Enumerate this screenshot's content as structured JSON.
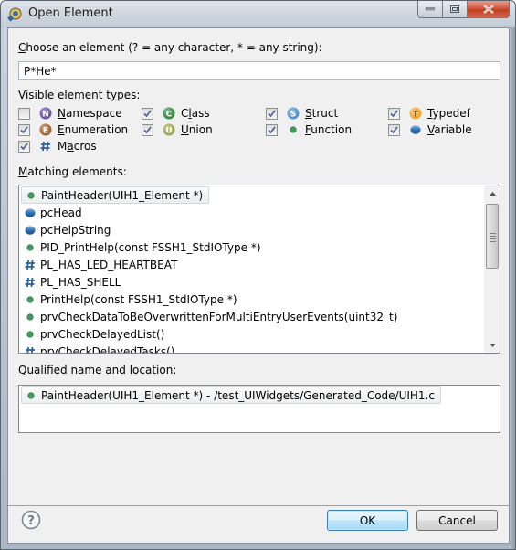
{
  "window": {
    "title": "Open Element",
    "caption_buttons": [
      "minimize",
      "maximize",
      "close"
    ]
  },
  "filter": {
    "label": "Choose an element (? = any character, * = any string):",
    "mnemonic_char": "C",
    "value": "P*He*"
  },
  "types": {
    "label": "Visible element types:",
    "items": [
      {
        "label": "Namespace",
        "mnemonic": "N",
        "checked": false,
        "icon": "namespace-icon",
        "color": "#6b4fa6"
      },
      {
        "label": "Class",
        "mnemonic": "l",
        "checked": true,
        "icon": "class-icon",
        "color": "#2e8b3e"
      },
      {
        "label": "Struct",
        "mnemonic": "S",
        "checked": true,
        "icon": "struct-icon",
        "color": "#4a93cf"
      },
      {
        "label": "Typedef",
        "mnemonic": "T",
        "checked": true,
        "icon": "typedef-icon",
        "color": "#f0a830"
      },
      {
        "label": "Enumeration",
        "mnemonic": "E",
        "checked": true,
        "icon": "enumeration-icon",
        "color": "#a0622a"
      },
      {
        "label": "Union",
        "mnemonic": "U",
        "checked": true,
        "icon": "union-icon",
        "color": "#9aa84a"
      },
      {
        "label": "Function",
        "mnemonic": "F",
        "checked": true,
        "icon": "function-icon",
        "color": "#3f9a5c"
      },
      {
        "label": "Variable",
        "mnemonic": "V",
        "checked": true,
        "icon": "variable-icon",
        "color": "#2f6fb5"
      },
      {
        "label": "Macros",
        "mnemonic": "a",
        "checked": true,
        "icon": "macro-icon",
        "color": "#2c5f9e"
      }
    ]
  },
  "matching": {
    "label": "Matching elements:",
    "items": [
      {
        "text": "PaintHeader(UIH1_Element *)",
        "kind": "function",
        "selected": true
      },
      {
        "text": "pcHead",
        "kind": "variable",
        "selected": false
      },
      {
        "text": "pcHelpString",
        "kind": "variable",
        "selected": false
      },
      {
        "text": "PID_PrintHelp(const FSSH1_StdIOType *)",
        "kind": "function",
        "selected": false
      },
      {
        "text": "PL_HAS_LED_HEARTBEAT",
        "kind": "macro",
        "selected": false
      },
      {
        "text": "PL_HAS_SHELL",
        "kind": "macro",
        "selected": false
      },
      {
        "text": "PrintHelp(const FSSH1_StdIOType *)",
        "kind": "function",
        "selected": false
      },
      {
        "text": "prvCheckDataToBeOverwrittenForMultiEntryUserEvents(uint32_t)",
        "kind": "function",
        "selected": false
      },
      {
        "text": "prvCheckDelayedList()",
        "kind": "function",
        "selected": false
      },
      {
        "text": "prvCheckDelayedTasks()",
        "kind": "macro",
        "selected": false
      }
    ]
  },
  "qualified": {
    "label": "Qualified name and location:",
    "items": [
      {
        "text": "PaintHeader(UIH1_Element *) - /test_UIWidgets/Generated_Code/UIH1.c",
        "kind": "function"
      }
    ]
  },
  "buttons": {
    "ok": "OK",
    "cancel": "Cancel",
    "help": "help-icon"
  }
}
